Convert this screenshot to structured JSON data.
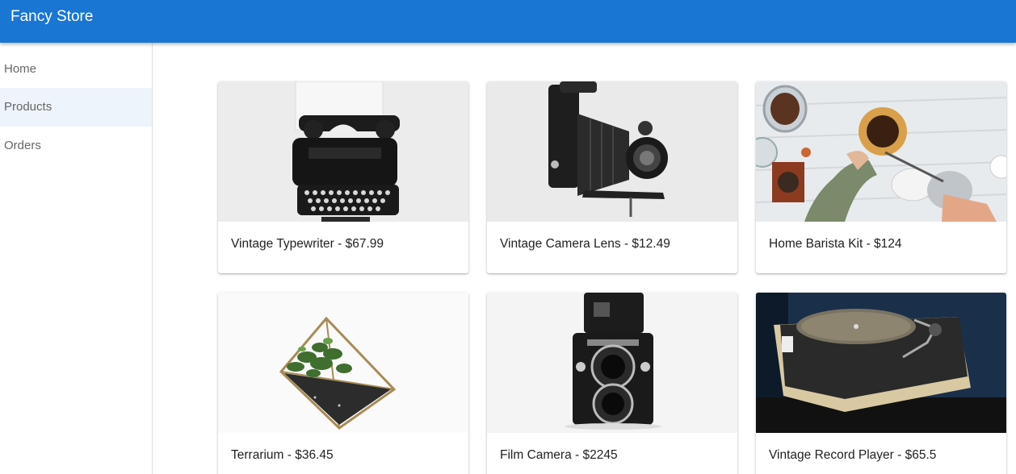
{
  "app": {
    "title": "Fancy Store"
  },
  "sidebar": {
    "items": [
      {
        "label": "Home",
        "active": false
      },
      {
        "label": "Products",
        "active": true
      },
      {
        "label": "Orders",
        "active": false
      }
    ]
  },
  "products": [
    {
      "label": "Vintage Typewriter - $67.99",
      "image": "typewriter-photo"
    },
    {
      "label": "Vintage Camera Lens - $12.49",
      "image": "folding-camera-photo"
    },
    {
      "label": "Home Barista Kit - $124",
      "image": "coffee-kit-photo"
    },
    {
      "label": "Terrarium - $36.45",
      "image": "terrarium-photo"
    },
    {
      "label": "Film Camera - $2245",
      "image": "twin-lens-camera-photo"
    },
    {
      "label": "Vintage Record Player - $65.5",
      "image": "record-player-photo"
    }
  ],
  "colors": {
    "appbar": "#1976d2",
    "active_nav": "#eef4fb"
  }
}
